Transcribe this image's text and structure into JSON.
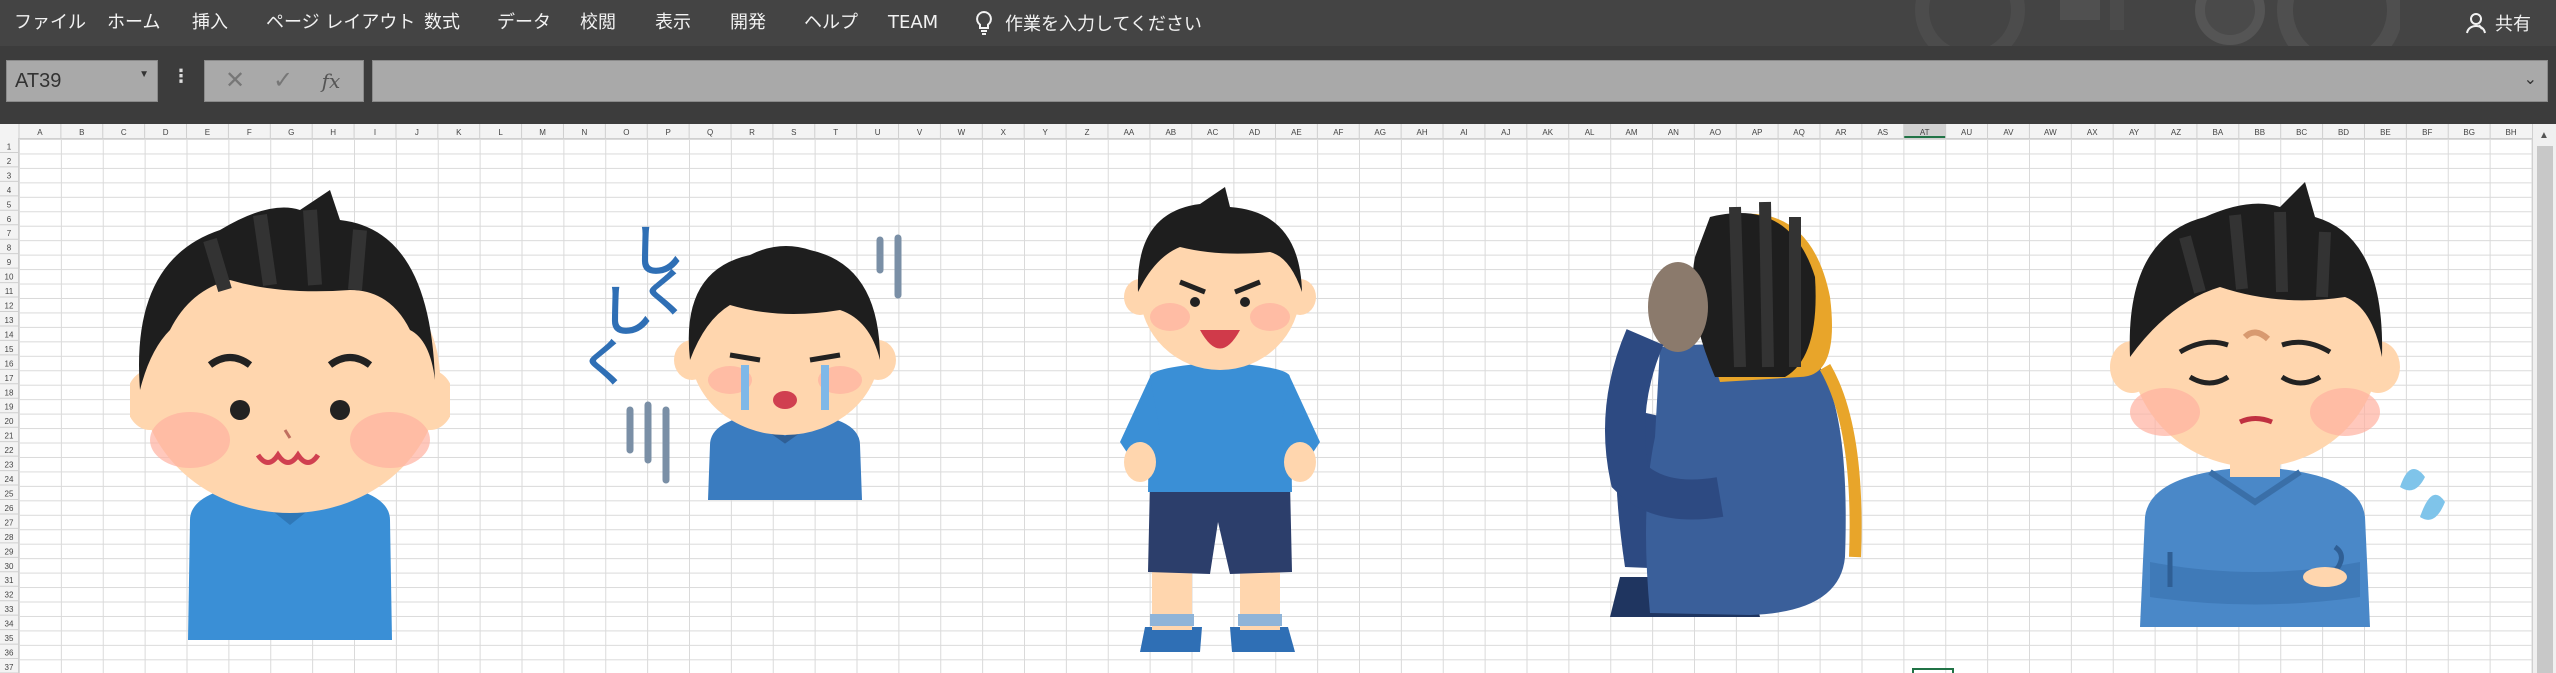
{
  "menu": {
    "items": [
      "ファイル",
      "ホーム",
      "挿入",
      "ページ レイアウト",
      "数式",
      "データ",
      "校閲",
      "表示",
      "開発",
      "ヘルプ",
      "TEAM"
    ],
    "tell_me": "作業を入力してください",
    "share": "共有"
  },
  "formula_bar": {
    "name_box": "AT39",
    "cancel_icon": "close-icon",
    "enter_icon": "check-icon",
    "function_label": "fx",
    "formula": ""
  },
  "sheet": {
    "selected_column": "AT",
    "columns": [
      "A",
      "B",
      "C",
      "D",
      "E",
      "F",
      "G",
      "H",
      "I",
      "J",
      "K",
      "L",
      "M",
      "N",
      "O",
      "P",
      "Q",
      "R",
      "S",
      "T",
      "U",
      "V",
      "W",
      "X",
      "Y",
      "Z",
      "AA",
      "AB",
      "AC",
      "AD",
      "AE",
      "AF",
      "AG",
      "AH",
      "AI",
      "AJ",
      "AK",
      "AL",
      "AM",
      "AN",
      "AO",
      "AP",
      "AQ",
      "AR",
      "AS",
      "AT",
      "AU",
      "AV",
      "AW",
      "AX",
      "AY",
      "AZ",
      "BA",
      "BB",
      "BC",
      "BD",
      "BE",
      "BF",
      "BG",
      "BH"
    ],
    "row_count": 37
  },
  "illustrations": [
    {
      "name": "smiling-boy",
      "sleeve": "#3a8fd6",
      "skin": "#ffd6ae"
    },
    {
      "name": "crying-boy",
      "sleeve": "#3a7cc0",
      "skin": "#ffd6ae",
      "tear_mark": "しくしく"
    },
    {
      "name": "happy-standing-boy",
      "sleeve": "#3a8fd6",
      "skin": "#ffd6ae"
    },
    {
      "name": "sitting-boy-back",
      "sleeve": "#3a5f9a",
      "skin": "#8b7a6c"
    },
    {
      "name": "troubled-boy-arms-crossed",
      "sleeve": "#4a88c8",
      "skin": "#ffd6ae"
    }
  ],
  "colors": {
    "menubar": "#444444",
    "formula_bar": "#3c3c3c",
    "hair": "#1e1e1e",
    "selected_header": "#217346"
  }
}
